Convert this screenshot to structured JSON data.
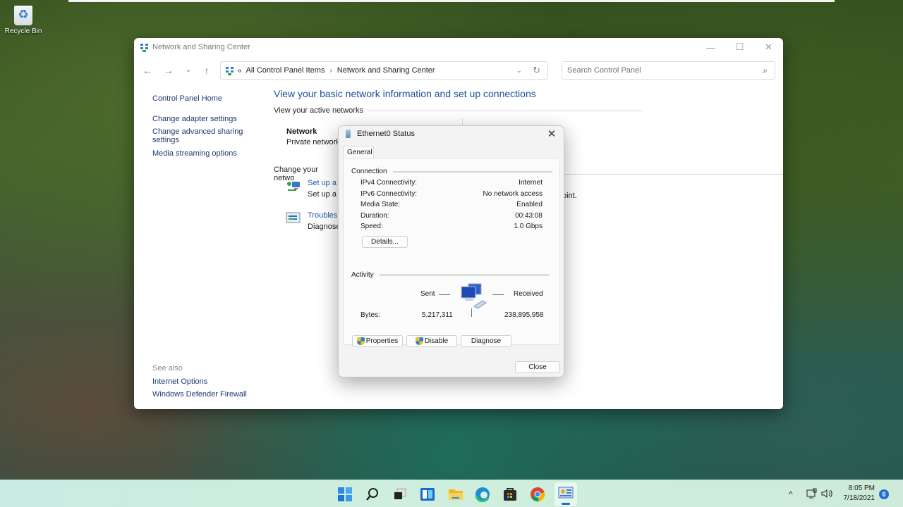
{
  "desktop": {
    "icons": [
      {
        "label": "Recycle Bin",
        "icon": "recycle-bin-icon"
      }
    ]
  },
  "window": {
    "title": "Network and Sharing Center",
    "controls": {
      "minimize": "—",
      "maximize": "☐",
      "close": "✕"
    },
    "nav": {
      "back": "←",
      "forward": "→",
      "recent": "⌄",
      "up": "↑"
    },
    "address": {
      "overflow": "«",
      "breadcrumbs": [
        "All Control Panel Items",
        "Network and Sharing Center"
      ],
      "separator": "›",
      "dropdown": "⌄",
      "refresh": "↻"
    },
    "search": {
      "placeholder": "Search Control Panel",
      "icon": "⌕"
    },
    "leftnav": {
      "home": "Control Panel Home",
      "links": [
        "Change adapter settings",
        "Change advanced sharing settings",
        "Media streaming options"
      ],
      "see_also_label": "See also",
      "see_also": [
        "Internet Options",
        "Windows Defender Firewall"
      ]
    },
    "content": {
      "title": "View your basic network information and set up connections",
      "active_networks_label": "View your active networks",
      "network_name": "Network",
      "network_type": "Private network",
      "change_settings_label": "Change your netwo",
      "tasks": [
        {
          "link": "Set up a r",
          "desc": "Set up a b",
          "icon": "new-connection-icon"
        },
        {
          "link": "Troublesh",
          "desc": "Diagnose",
          "icon": "troubleshoot-icon"
        }
      ],
      "partial_text": "oint."
    }
  },
  "dialog": {
    "title": "Ethernet0 Status",
    "close": "✕",
    "tab": "General",
    "connection": {
      "label": "Connection",
      "rows": [
        {
          "key": "IPv4 Connectivity:",
          "value": "Internet"
        },
        {
          "key": "IPv6 Connectivity:",
          "value": "No network access"
        },
        {
          "key": "Media State:",
          "value": "Enabled"
        },
        {
          "key": "Duration:",
          "value": "00:43:08"
        },
        {
          "key": "Speed:",
          "value": "1.0 Gbps"
        }
      ],
      "details_button": "Details..."
    },
    "activity": {
      "label": "Activity",
      "sent_label": "Sent",
      "received_label": "Received",
      "bytes_label": "Bytes:",
      "bytes_sent": "5,217,311",
      "bytes_received": "238,895,958"
    },
    "buttons": {
      "properties": "Properties",
      "disable": "Disable",
      "diagnose": "Diagnose",
      "close": "Close"
    }
  },
  "taskbar": {
    "apps": [
      "start",
      "search",
      "task-view",
      "widgets",
      "file-explorer",
      "edge",
      "store",
      "chrome",
      "control-panel"
    ],
    "tray": {
      "chevron": "^",
      "time": "8:05 PM",
      "date": "7/18/2021",
      "notifications": "6"
    }
  },
  "colors": {
    "link": "#1b5aa8",
    "title": "#1b4f9a",
    "accent": "#1f6fd1"
  }
}
